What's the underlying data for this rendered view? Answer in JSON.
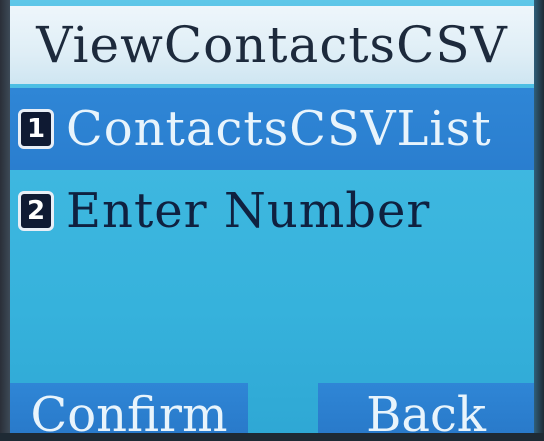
{
  "title": "ViewContactsCSV",
  "menu": {
    "items": [
      {
        "number": "1",
        "label": "ContactsCSVList",
        "selected": true
      },
      {
        "number": "2",
        "label": "Enter Number",
        "selected": false
      }
    ]
  },
  "softkeys": {
    "left": "Confirm",
    "right": "Back"
  },
  "colors": {
    "background": "#3fb8e0",
    "highlight": "#2f86d6",
    "title_bar": "#dfeef6",
    "text_dark": "#0f2140",
    "text_light": "#e8f4fc"
  }
}
